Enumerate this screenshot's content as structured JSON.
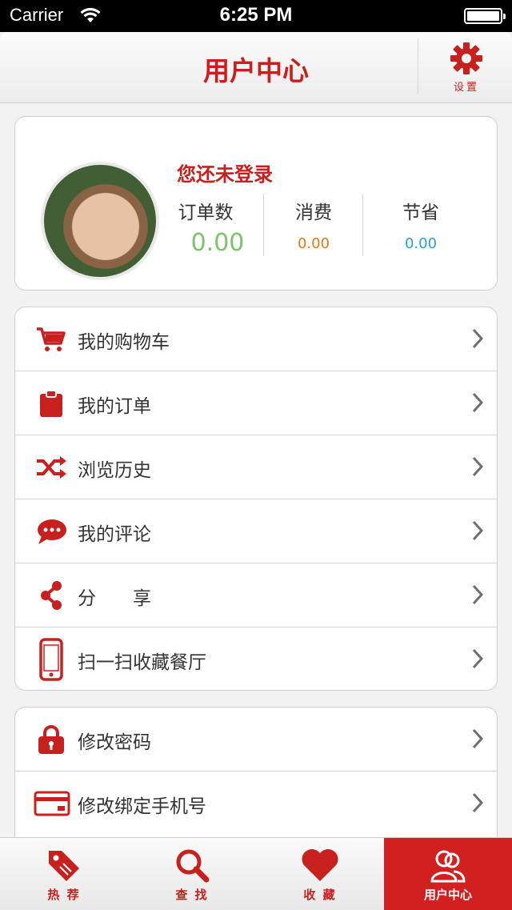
{
  "status_bar": {
    "carrier": "Carrier",
    "time": "6:25 PM"
  },
  "nav": {
    "title": "用户中心",
    "settings_label": "设置"
  },
  "profile": {
    "login_tip": "您还未登录",
    "stats": [
      {
        "label": "订单数",
        "value": "0.00",
        "color": "#7cc36a"
      },
      {
        "label": "消费",
        "value": "0.00",
        "color": "#e07a1a"
      },
      {
        "label": "节省",
        "value": "0.00",
        "color": "#2a9fd6"
      }
    ]
  },
  "menu": {
    "group1": [
      {
        "label": "我的购物车",
        "icon": "cart-icon"
      },
      {
        "label": "我的订单",
        "icon": "clipboard-icon"
      },
      {
        "label": "浏览历史",
        "icon": "shuffle-icon"
      },
      {
        "label": "我的评论",
        "icon": "comment-icon"
      },
      {
        "label": "分　　享",
        "icon": "share-icon"
      },
      {
        "label": "扫一扫收藏餐厅",
        "icon": "phone-icon"
      }
    ],
    "group2": [
      {
        "label": "修改密码",
        "icon": "lock-icon"
      },
      {
        "label": "修改绑定手机号",
        "icon": "card-icon"
      }
    ]
  },
  "tabbar": {
    "tabs": [
      {
        "label": "热 荐",
        "icon": "tag-icon"
      },
      {
        "label": "查 找",
        "icon": "search-icon"
      },
      {
        "label": "收 藏",
        "icon": "heart-icon"
      },
      {
        "label": "用户中心",
        "icon": "user-icon",
        "active": true
      }
    ]
  },
  "colors": {
    "accent": "#c8201f",
    "tab_active_bg": "#d21f1f"
  }
}
